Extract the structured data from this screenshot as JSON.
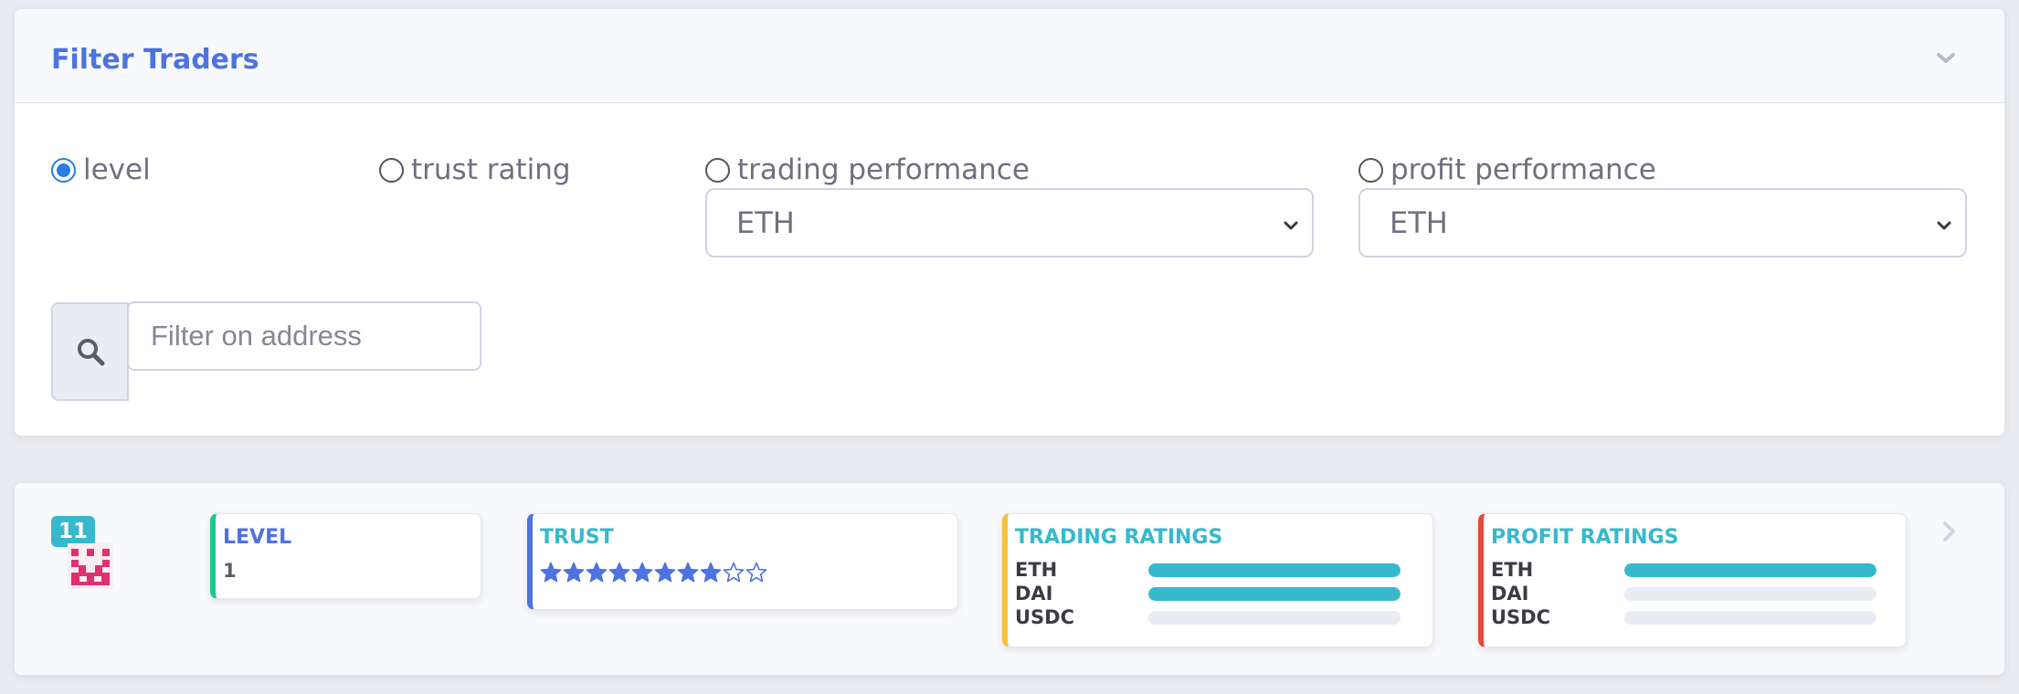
{
  "filter_panel": {
    "title": "Filter Traders",
    "collapse_icon": "chevron-down-icon",
    "sort_options": [
      {
        "label": "level",
        "checked": true
      },
      {
        "label": "trust rating",
        "checked": false
      },
      {
        "label": "trading performance",
        "checked": false
      },
      {
        "label": "profit performance",
        "checked": false
      }
    ],
    "trading_select": {
      "value": "ETH"
    },
    "profit_select": {
      "value": "ETH"
    },
    "search": {
      "icon": "search-icon",
      "placeholder": "Filter on address",
      "value": ""
    }
  },
  "trader": {
    "rank": "11",
    "avatar_icon": "identicon-avatar",
    "level": {
      "title": "LEVEL",
      "value": "1"
    },
    "trust": {
      "title": "TRUST",
      "stars_filled": 8,
      "stars_total": 10
    },
    "trading_ratings": {
      "title": "TRADING RATINGS",
      "rows": [
        {
          "label": "ETH",
          "fill": 1.0
        },
        {
          "label": "DAI",
          "fill": 1.0
        },
        {
          "label": "USDC",
          "fill": 0.0
        }
      ]
    },
    "profit_ratings": {
      "title": "PROFIT RATINGS",
      "rows": [
        {
          "label": "ETH",
          "fill": 1.0
        },
        {
          "label": "DAI",
          "fill": 0.0
        },
        {
          "label": "USDC",
          "fill": 0.0
        }
      ]
    },
    "next_icon": "chevron-right-icon"
  },
  "colors": {
    "primary": "#4e73df",
    "info": "#36b9cc",
    "success": "#1cc88a",
    "warning": "#f6c23e",
    "danger": "#e74a3b"
  }
}
